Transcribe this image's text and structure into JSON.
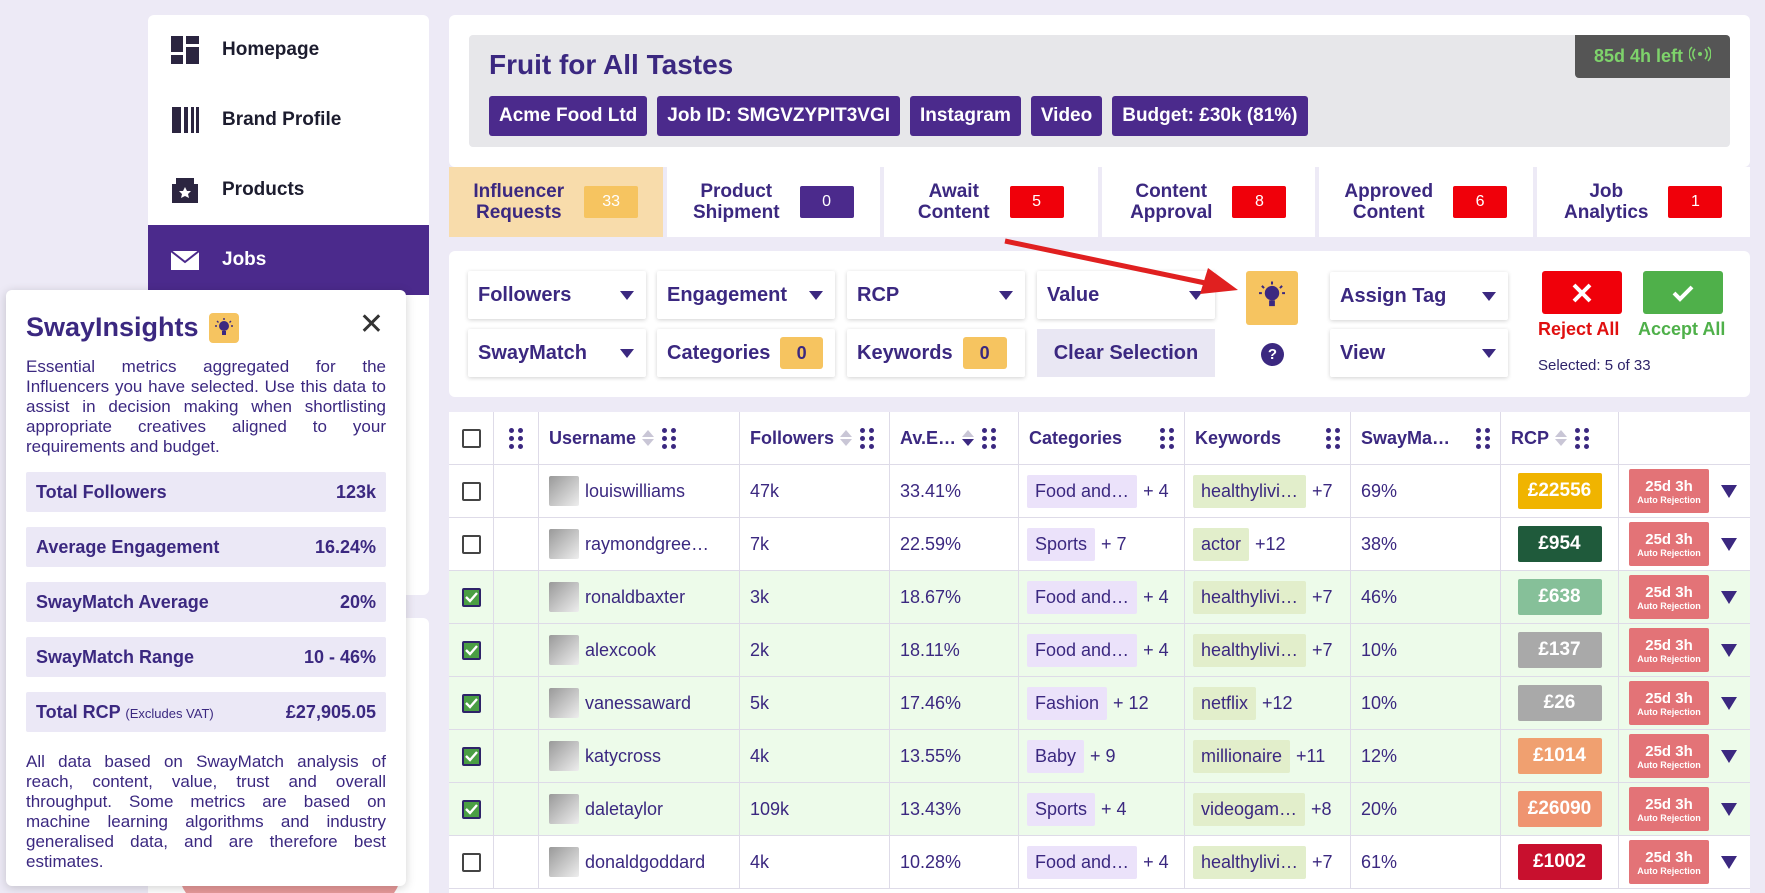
{
  "nav": [
    {
      "label": "Homepage",
      "icon": "dashboard-icon"
    },
    {
      "label": "Brand Profile",
      "icon": "brand-profile-icon"
    },
    {
      "label": "Products",
      "icon": "products-icon"
    },
    {
      "label": "Jobs",
      "icon": "jobs-icon",
      "active": true
    }
  ],
  "insights": {
    "title": "SwayInsights",
    "description": "Essential metrics aggregated for the Influencers you have selected. Use this data to assist in decision making when shortlisting appropriate creatives aligned to your requirements and budget.",
    "metrics": [
      {
        "label": "Total Followers",
        "value": "123k",
        "sub": ""
      },
      {
        "label": "Average Engagement",
        "value": "16.24%",
        "sub": ""
      },
      {
        "label": "SwayMatch Average",
        "value": "20%",
        "sub": ""
      },
      {
        "label": "SwayMatch Range",
        "value": "10 - 46%",
        "sub": ""
      },
      {
        "label": "Total RCP",
        "value": "£27,905.05",
        "sub": "(Excludes VAT)"
      }
    ],
    "footer": "All data based on SwayMatch analysis of reach, content, value, trust and overall throughput. Some metrics are based on machine learning algorithms and industry generalised data, and are therefore best estimates."
  },
  "job": {
    "title": "Fruit for All Tastes",
    "time_left": "85d 4h left",
    "chips": [
      "Acme Food Ltd",
      "Job ID: SMGVZYPIT3VGI",
      "Instagram",
      "Video",
      "Budget: £30k (81%)"
    ]
  },
  "tabs": [
    {
      "label": "Influencer\nRequests",
      "count": "33",
      "color": "#f6c460",
      "active": true
    },
    {
      "label": "Product\nShipment",
      "count": "0",
      "color": "#4b2a8c"
    },
    {
      "label": "Await\nContent",
      "count": "5",
      "color": "#f0000a"
    },
    {
      "label": "Content\nApproval",
      "count": "8",
      "color": "#f0000a"
    },
    {
      "label": "Approved\nContent",
      "count": "6",
      "color": "#f0000a"
    },
    {
      "label": "Job\nAnalytics",
      "count": "1",
      "color": "#f0000a"
    }
  ],
  "filters": {
    "followers": "Followers",
    "engagement": "Engagement",
    "rcp": "RCP",
    "value": "Value",
    "swaymatch": "SwayMatch",
    "categories": "Categories",
    "categories_count": "0",
    "keywords": "Keywords",
    "keywords_count": "0",
    "clear": "Clear Selection",
    "assign_tag": "Assign Tag",
    "view": "View",
    "help": "?",
    "reject_all": "Reject All",
    "accept_all": "Accept All",
    "selected": "Selected: 5 of 33"
  },
  "table": {
    "headers": {
      "username": "Username",
      "followers": "Followers",
      "engagement": "Av.E…",
      "categories": "Categories",
      "keywords": "Keywords",
      "swaymatch": "SwayMa…",
      "rcp": "RCP"
    },
    "rows": [
      {
        "selected": false,
        "username": "louiswilliams",
        "followers": "47k",
        "engagement": "33.41%",
        "category": "Food and…",
        "cat_more": "+ 4",
        "keyword": "healthylivi…",
        "kw_more": "+7",
        "swaymatch": "69%",
        "rcp": "£22556",
        "rcp_color": "#f0b400",
        "rejection": "25d 3h",
        "rejection_sub": "Auto Rejection"
      },
      {
        "selected": false,
        "username": "raymondgree…",
        "followers": "7k",
        "engagement": "22.59%",
        "category": "Sports",
        "cat_more": "+ 7",
        "keyword": "actor",
        "kw_more": "+12",
        "swaymatch": "38%",
        "rcp": "£954",
        "rcp_color": "#1f5a3b",
        "rejection": "25d 3h",
        "rejection_sub": "Auto Rejection"
      },
      {
        "selected": true,
        "username": "ronaldbaxter",
        "followers": "3k",
        "engagement": "18.67%",
        "category": "Food and…",
        "cat_more": "+ 4",
        "keyword": "healthylivi…",
        "kw_more": "+7",
        "swaymatch": "46%",
        "rcp": "£638",
        "rcp_color": "#86c099",
        "rejection": "25d 3h",
        "rejection_sub": "Auto Rejection"
      },
      {
        "selected": true,
        "username": "alexcook",
        "followers": "2k",
        "engagement": "18.11%",
        "category": "Food and…",
        "cat_more": "+ 4",
        "keyword": "healthylivi…",
        "kw_more": "+7",
        "swaymatch": "10%",
        "rcp": "£137",
        "rcp_color": "#a9a9a9",
        "rejection": "25d 3h",
        "rejection_sub": "Auto Rejection"
      },
      {
        "selected": true,
        "username": "vanessaward",
        "followers": "5k",
        "engagement": "17.46%",
        "category": "Fashion",
        "cat_more": "+ 12",
        "keyword": "netflix",
        "kw_more": "+12",
        "swaymatch": "10%",
        "rcp": "£26",
        "rcp_color": "#a9a9a9",
        "rejection": "25d 3h",
        "rejection_sub": "Auto Rejection"
      },
      {
        "selected": true,
        "username": "katycross",
        "followers": "4k",
        "engagement": "13.55%",
        "category": "Baby",
        "cat_more": "+ 9",
        "keyword": "millionaire",
        "kw_more": "+11",
        "swaymatch": "12%",
        "rcp": "£1014",
        "rcp_color": "#f0a070",
        "rejection": "25d 3h",
        "rejection_sub": "Auto Rejection"
      },
      {
        "selected": true,
        "username": "daletaylor",
        "followers": "109k",
        "engagement": "13.43%",
        "category": "Sports",
        "cat_more": "+ 4",
        "keyword": "videogam…",
        "kw_more": "+8",
        "swaymatch": "20%",
        "rcp": "£26090",
        "rcp_color": "#ef9470",
        "rejection": "25d 3h",
        "rejection_sub": "Auto Rejection"
      },
      {
        "selected": false,
        "username": "donaldgoddard",
        "followers": "4k",
        "engagement": "10.28%",
        "category": "Food and…",
        "cat_more": "+ 4",
        "keyword": "healthylivi…",
        "kw_more": "+7",
        "swaymatch": "61%",
        "rcp": "£1002",
        "rcp_color": "#c8102e",
        "rejection": "25d 3h",
        "rejection_sub": "Auto Rejection"
      }
    ]
  }
}
